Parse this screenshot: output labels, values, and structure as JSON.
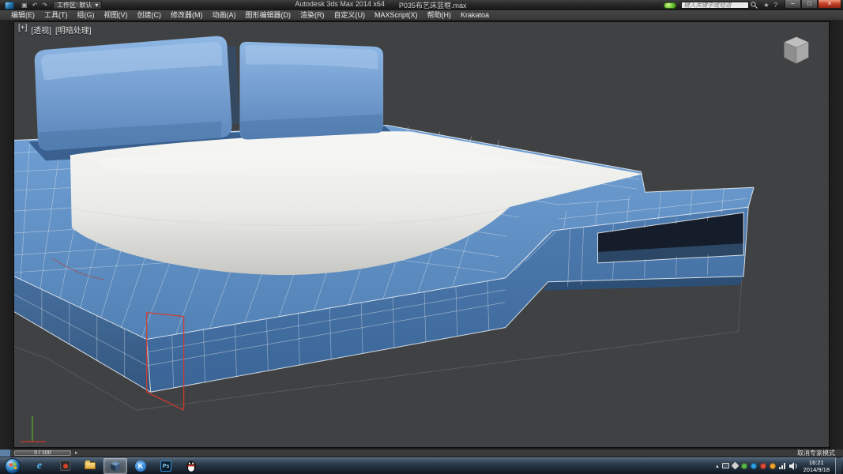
{
  "titlebar": {
    "app_title": "Autodesk 3ds Max 2014 x64",
    "doc_title": "P035布艺床蓝框.max",
    "workspace_label": "工作区: 默认",
    "search_placeholder": "键入关键字或短语"
  },
  "menubar": {
    "items": [
      "编辑(E)",
      "工具(T)",
      "组(G)",
      "视图(V)",
      "创建(C)",
      "修改器(M)",
      "动画(A)",
      "图形编辑器(D)",
      "渲染(R)",
      "自定义(U)",
      "MAXScript(X)",
      "帮助(H)",
      "Krakatoa"
    ]
  },
  "viewport": {
    "label_menu": "[+]",
    "label_view": "[透视]",
    "label_shading": "[明暗处理]"
  },
  "timeline": {
    "frame_indicator": "0 / 100"
  },
  "statusbar": {
    "expert_mode_button": "取消专家模式"
  },
  "taskbar": {
    "clock_time": "16:21",
    "clock_date": "2014/9/18"
  },
  "icons": {
    "minimize": "–",
    "maximize": "□",
    "close": "×",
    "dropdown_arrow": "▾",
    "save": "▣",
    "undo": "↶",
    "redo": "↷",
    "favorites_star": "★",
    "help": "?",
    "timeline_arrow": "▸",
    "tray_hidden_arrow": "▴",
    "ie_letter": "e",
    "k_letter": "K",
    "ps_label": "Ps"
  },
  "colors": {
    "bed_blue": "#5e8fc4",
    "mattress_white": "#f0f0ee",
    "viewport_bg": "#3f4143",
    "selection_red": "#d23b2e",
    "close_button_red": "#c6452c"
  }
}
